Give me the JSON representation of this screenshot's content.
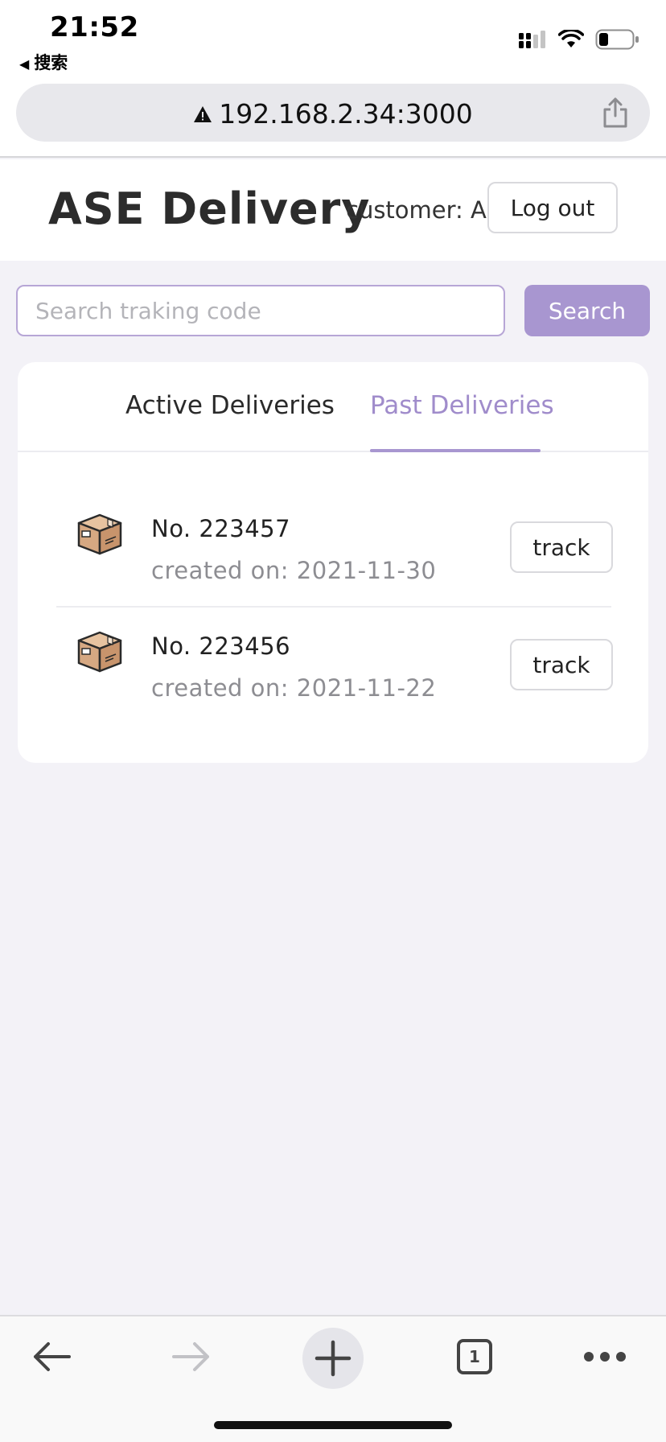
{
  "status_bar": {
    "time": "21:52",
    "back_label": "搜索",
    "icons": [
      "cellular-signal-icon",
      "wifi-icon",
      "battery-icon"
    ]
  },
  "browser": {
    "url": "192.168.2.34:3000",
    "tab_count": "1",
    "icons": [
      "warning-icon",
      "share-icon",
      "back-arrow-icon",
      "forward-arrow-icon",
      "plus-icon",
      "tabs-icon",
      "more-icon"
    ]
  },
  "header": {
    "brand": "ASE Delivery",
    "user_label": "customer: A",
    "logout_label": "Log out"
  },
  "search": {
    "placeholder": "Search traking code",
    "value": "",
    "button_label": "Search"
  },
  "tabs": [
    {
      "label": "Active Deliveries",
      "selected": false
    },
    {
      "label": "Past Deliveries",
      "selected": true
    }
  ],
  "deliveries": [
    {
      "number": "No. 223457",
      "created": "created on: 2021-11-30",
      "action_label": "track",
      "icon": "package-box-icon"
    },
    {
      "number": "No. 223456",
      "created": "created on: 2021-11-22",
      "action_label": "track",
      "icon": "package-box-icon"
    }
  ],
  "colors": {
    "accent": "#a896d0",
    "accent_text": "#a08ccb",
    "page_background": "#f3f2f7",
    "card_background": "#ffffff"
  }
}
